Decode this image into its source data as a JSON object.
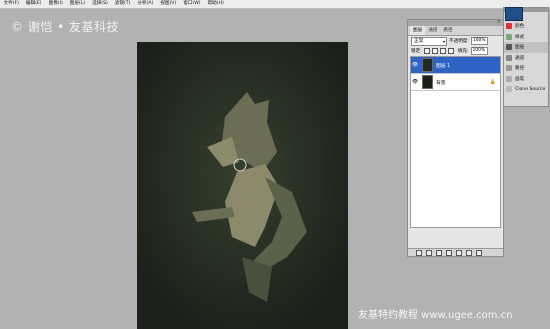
{
  "menubar": {
    "items": [
      "文件(F)",
      "编辑(E)",
      "图像(I)",
      "图层(L)",
      "选择(S)",
      "滤镜(T)",
      "分析(A)",
      "视图(V)",
      "窗口(W)",
      "帮助(H)"
    ]
  },
  "watermark": {
    "top": "© 谢恺 • 友基科技",
    "bottom": "友基特约教程 www.ugee.com.cn"
  },
  "layers_panel": {
    "tabs": [
      "图层",
      "通道",
      "路径"
    ],
    "blend_mode": "正常",
    "opacity_label": "不透明度:",
    "opacity_value": "100%",
    "lock_label": "锁定:",
    "fill_label": "填充:",
    "fill_value": "100%",
    "layers": [
      {
        "name": "图层 1",
        "selected": true
      },
      {
        "name": "背景",
        "selected": false
      }
    ],
    "close_glyph": "×",
    "eye_glyph": "👁",
    "lock_glyph": "🔒"
  },
  "mini_panel": {
    "items": [
      "颜色",
      "样式",
      "图层",
      "通道",
      "路径",
      "画笔",
      "Clone Source"
    ],
    "active_index": 2
  },
  "colors": {
    "workspace": "#b2b2b2",
    "canvas": "#1f231d",
    "selection": "#2f63c4"
  }
}
